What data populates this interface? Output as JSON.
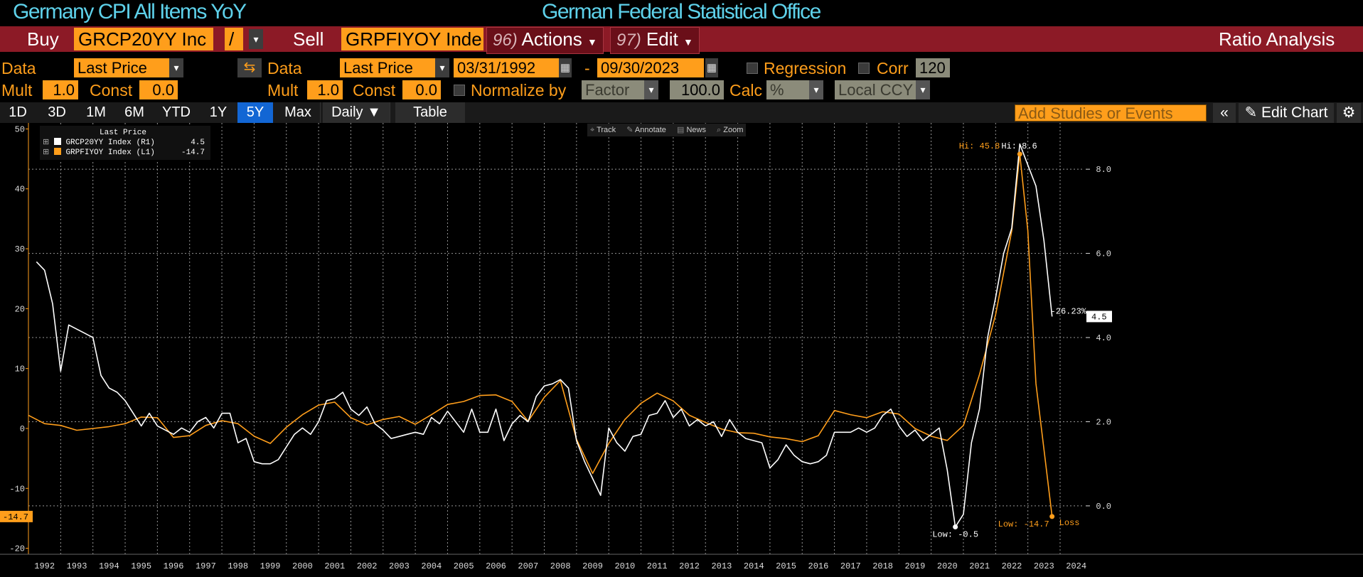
{
  "header": {
    "title": "Germany CPI All Items YoY",
    "source": "German Federal Statistical Office"
  },
  "toolbar": {
    "buy_label": "Buy",
    "buy_ticker": "GRCP20YY Inc",
    "operator": "/",
    "sell_label": "Sell",
    "sell_ticker": "GRPFIYOY Inde",
    "actions_num": "96)",
    "actions_label": "Actions",
    "edit_num": "97)",
    "edit_label": "Edit",
    "ratio_analysis": "Ratio Analysis"
  },
  "settings": {
    "data_label": "Data",
    "data_left": "Last Price",
    "data_label2": "Data",
    "data_right": "Last Price",
    "start_date": "03/31/1992",
    "dash": "-",
    "end_date": "09/30/2023",
    "regression_label": "Regression",
    "corr_label": "Corr",
    "corr_value": "120",
    "mult_label": "Mult",
    "mult_left": "1.0",
    "const_label": "Const",
    "const_left": "0.0",
    "mult_label2": "Mult",
    "mult_right": "1.0",
    "const_label2": "Const",
    "const_right": "0.0",
    "normalize_label": "Normalize by",
    "normalize_value": "Factor",
    "normalize_number": "100.0",
    "calc_label": "Calc",
    "calc_value": "%",
    "currency": "Local CCY"
  },
  "tabs": [
    {
      "label": "1D"
    },
    {
      "label": "3D"
    },
    {
      "label": "1M"
    },
    {
      "label": "6M"
    },
    {
      "label": "YTD"
    },
    {
      "label": "1Y"
    },
    {
      "label": "5Y"
    },
    {
      "label": "Max"
    },
    {
      "label": "Daily ▼"
    },
    {
      "label": "Table"
    }
  ],
  "active_tab": "5Y",
  "studies_placeholder": "Add Studies or Events",
  "edit_chart_label": "Edit Chart",
  "chart_tools": [
    "Track",
    "Annotate",
    "News",
    "Zoom"
  ],
  "colors": {
    "white_series": "#ffffff",
    "orange_series": "#ff9e1b",
    "accent": "#ff9e1b",
    "title": "#5ed1ea",
    "bar": "#8c1a26"
  },
  "chart_data": {
    "type": "line",
    "legend_title": "Last Price",
    "legend_placement": "top-left",
    "grid": true,
    "x_tick_labels": [
      "1992",
      "1993",
      "1994",
      "1995",
      "1996",
      "1997",
      "1998",
      "1999",
      "2000",
      "2001",
      "2002",
      "2003",
      "2004",
      "2005",
      "2006",
      "2007",
      "2008",
      "2009",
      "2010",
      "2011",
      "2012",
      "2013",
      "2014",
      "2015",
      "2016",
      "2017",
      "2018",
      "2019",
      "2020",
      "2021",
      "2022",
      "2023",
      "2024"
    ],
    "xlim": [
      1992.0,
      2024.75
    ],
    "left_axis": {
      "ylim": [
        -21,
        51
      ],
      "ticks": [
        -20,
        -10,
        0,
        10,
        20,
        30,
        40,
        50
      ],
      "tick_labels": [
        "-20",
        "-10",
        "0",
        "10",
        "20",
        "30",
        "40",
        "50"
      ]
    },
    "right_axis": {
      "ylim": [
        -1.15,
        9.1
      ],
      "ticks": [
        0,
        2,
        4,
        6,
        8
      ],
      "tick_labels": [
        "0.0",
        "2.0",
        "4.0",
        "6.0",
        "8.0"
      ]
    },
    "series": [
      {
        "name": "GRCP20YY Index",
        "axis": "R1",
        "last_value_label": "4.5",
        "last_value": 4.5,
        "points": [
          [
            1992.25,
            5.8
          ],
          [
            1992.5,
            5.6
          ],
          [
            1992.75,
            4.8
          ],
          [
            1993.0,
            3.2
          ],
          [
            1993.25,
            4.3
          ],
          [
            1993.5,
            4.2
          ],
          [
            1993.75,
            4.1
          ],
          [
            1994.0,
            4.0
          ],
          [
            1994.25,
            3.1
          ],
          [
            1994.5,
            2.8
          ],
          [
            1994.75,
            2.7
          ],
          [
            1995.0,
            2.5
          ],
          [
            1995.25,
            2.2
          ],
          [
            1995.5,
            1.9
          ],
          [
            1995.75,
            2.2
          ],
          [
            1996.0,
            1.9
          ],
          [
            1996.25,
            1.8
          ],
          [
            1996.5,
            1.7
          ],
          [
            1996.75,
            1.85
          ],
          [
            1997.0,
            1.75
          ],
          [
            1997.25,
            2.0
          ],
          [
            1997.5,
            2.1
          ],
          [
            1997.75,
            1.85
          ],
          [
            1998.0,
            2.2
          ],
          [
            1998.25,
            2.2
          ],
          [
            1998.5,
            1.5
          ],
          [
            1998.75,
            1.6
          ],
          [
            1999.0,
            1.05
          ],
          [
            1999.25,
            1.0
          ],
          [
            1999.5,
            1.0
          ],
          [
            1999.75,
            1.1
          ],
          [
            2000.0,
            1.4
          ],
          [
            2000.25,
            1.7
          ],
          [
            2000.5,
            1.85
          ],
          [
            2000.75,
            1.7
          ],
          [
            2001.0,
            2.0
          ],
          [
            2001.25,
            2.5
          ],
          [
            2001.5,
            2.55
          ],
          [
            2001.75,
            2.7
          ],
          [
            2002.0,
            2.3
          ],
          [
            2002.25,
            2.15
          ],
          [
            2002.5,
            2.35
          ],
          [
            2002.75,
            1.95
          ],
          [
            2003.0,
            1.8
          ],
          [
            2003.25,
            1.6
          ],
          [
            2003.5,
            1.65
          ],
          [
            2003.75,
            1.7
          ],
          [
            2004.0,
            1.75
          ],
          [
            2004.25,
            1.7
          ],
          [
            2004.5,
            2.1
          ],
          [
            2004.75,
            1.95
          ],
          [
            2005.0,
            2.25
          ],
          [
            2005.25,
            2.0
          ],
          [
            2005.5,
            1.75
          ],
          [
            2005.75,
            2.3
          ],
          [
            2006.0,
            1.75
          ],
          [
            2006.25,
            1.75
          ],
          [
            2006.5,
            2.3
          ],
          [
            2006.75,
            1.55
          ],
          [
            2007.0,
            1.95
          ],
          [
            2007.25,
            2.15
          ],
          [
            2007.5,
            2.0
          ],
          [
            2007.75,
            2.6
          ],
          [
            2008.0,
            2.85
          ],
          [
            2008.25,
            2.9
          ],
          [
            2008.5,
            3.0
          ],
          [
            2008.75,
            2.8
          ],
          [
            2009.0,
            1.55
          ],
          [
            2009.25,
            1.05
          ],
          [
            2009.5,
            0.65
          ],
          [
            2009.75,
            0.25
          ],
          [
            2010.0,
            1.85
          ],
          [
            2010.25,
            1.5
          ],
          [
            2010.5,
            1.3
          ],
          [
            2010.75,
            1.65
          ],
          [
            2011.0,
            1.7
          ],
          [
            2011.25,
            2.15
          ],
          [
            2011.5,
            2.2
          ],
          [
            2011.75,
            2.5
          ],
          [
            2012.0,
            2.1
          ],
          [
            2012.25,
            2.3
          ],
          [
            2012.5,
            1.9
          ],
          [
            2012.75,
            2.05
          ],
          [
            2013.0,
            1.9
          ],
          [
            2013.25,
            2.0
          ],
          [
            2013.5,
            1.65
          ],
          [
            2013.75,
            2.05
          ],
          [
            2014.0,
            1.75
          ],
          [
            2014.25,
            1.6
          ],
          [
            2014.5,
            1.55
          ],
          [
            2014.75,
            1.5
          ],
          [
            2015.0,
            0.9
          ],
          [
            2015.25,
            1.1
          ],
          [
            2015.5,
            1.45
          ],
          [
            2015.75,
            1.2
          ],
          [
            2016.0,
            1.05
          ],
          [
            2016.25,
            1.0
          ],
          [
            2016.5,
            1.05
          ],
          [
            2016.75,
            1.2
          ],
          [
            2017.0,
            1.75
          ],
          [
            2017.25,
            1.75
          ],
          [
            2017.5,
            1.75
          ],
          [
            2017.75,
            1.85
          ],
          [
            2018.0,
            1.75
          ],
          [
            2018.25,
            1.85
          ],
          [
            2018.5,
            2.15
          ],
          [
            2018.75,
            2.3
          ],
          [
            2018.0,
            1.75
          ],
          [
            2019.0,
            1.9
          ],
          [
            2019.25,
            1.65
          ],
          [
            2019.5,
            1.8
          ],
          [
            2019.75,
            1.55
          ],
          [
            2020.0,
            1.7
          ],
          [
            2020.25,
            1.85
          ],
          [
            2020.5,
            0.85
          ],
          [
            2020.75,
            -0.5
          ],
          [
            2021.0,
            -0.2
          ],
          [
            2021.25,
            1.5
          ],
          [
            2021.5,
            2.3
          ],
          [
            2021.75,
            4.0
          ],
          [
            2022.0,
            4.95
          ],
          [
            2022.25,
            6.0
          ],
          [
            2022.5,
            6.6
          ],
          [
            2022.75,
            8.6
          ],
          [
            2023.0,
            8.1
          ],
          [
            2023.25,
            7.6
          ],
          [
            2023.5,
            6.3
          ],
          [
            2023.75,
            4.5
          ]
        ]
      },
      {
        "name": "GRPFIYOY Index",
        "axis": "L1",
        "last_value_label": "-14.7",
        "last_value": -14.7,
        "points": [
          [
            1992.0,
            2.2
          ],
          [
            1992.5,
            0.8
          ],
          [
            1993.0,
            0.5
          ],
          [
            1993.5,
            -0.3
          ],
          [
            1994.0,
            0.0
          ],
          [
            1994.5,
            0.3
          ],
          [
            1995.0,
            0.8
          ],
          [
            1995.5,
            1.9
          ],
          [
            1996.0,
            1.8
          ],
          [
            1996.5,
            -1.5
          ],
          [
            1997.0,
            -1.2
          ],
          [
            1997.5,
            0.5
          ],
          [
            1998.0,
            1.3
          ],
          [
            1998.5,
            0.8
          ],
          [
            1999.0,
            -1.3
          ],
          [
            1999.5,
            -2.5
          ],
          [
            2000.0,
            0.2
          ],
          [
            2000.5,
            2.3
          ],
          [
            2001.0,
            3.9
          ],
          [
            2001.5,
            4.4
          ],
          [
            2002.0,
            1.8
          ],
          [
            2002.5,
            0.6
          ],
          [
            2003.0,
            1.5
          ],
          [
            2003.5,
            2.0
          ],
          [
            2004.0,
            0.7
          ],
          [
            2004.5,
            2.3
          ],
          [
            2005.0,
            4.0
          ],
          [
            2005.5,
            4.5
          ],
          [
            2006.0,
            5.5
          ],
          [
            2006.5,
            5.6
          ],
          [
            2007.0,
            4.5
          ],
          [
            2007.5,
            1.2
          ],
          [
            2008.0,
            5.2
          ],
          [
            2008.5,
            8.0
          ],
          [
            2009.0,
            -1.8
          ],
          [
            2009.5,
            -7.5
          ],
          [
            2010.0,
            -2.5
          ],
          [
            2010.5,
            1.5
          ],
          [
            2011.0,
            4.2
          ],
          [
            2011.5,
            5.9
          ],
          [
            2012.0,
            4.6
          ],
          [
            2012.5,
            2.2
          ],
          [
            2013.0,
            1.0
          ],
          [
            2013.5,
            -0.1
          ],
          [
            2014.0,
            -0.7
          ],
          [
            2014.5,
            -0.8
          ],
          [
            2015.0,
            -1.4
          ],
          [
            2015.5,
            -1.7
          ],
          [
            2016.0,
            -2.2
          ],
          [
            2016.5,
            -1.2
          ],
          [
            2017.0,
            3.0
          ],
          [
            2017.5,
            2.3
          ],
          [
            2018.0,
            1.8
          ],
          [
            2018.5,
            2.8
          ],
          [
            2019.0,
            2.4
          ],
          [
            2019.5,
            0.0
          ],
          [
            2020.0,
            -1.3
          ],
          [
            2020.5,
            -2.0
          ],
          [
            2021.0,
            0.5
          ],
          [
            2021.5,
            9.0
          ],
          [
            2021.75,
            14.0
          ],
          [
            2022.0,
            19.0
          ],
          [
            2022.25,
            26.0
          ],
          [
            2022.5,
            33.0
          ],
          [
            2022.75,
            45.8
          ],
          [
            2023.0,
            33.0
          ],
          [
            2023.25,
            7.5
          ],
          [
            2023.5,
            -3.5
          ],
          [
            2023.75,
            -14.7
          ]
        ]
      }
    ],
    "annotations": [
      {
        "text": "Hi: 45.8",
        "series": "GRPFIYOY Index",
        "x": 2022.75,
        "y": 45.8
      },
      {
        "text": "Hi: 8.6",
        "series": "GRCP20YY Index",
        "x": 2022.75,
        "y": 8.6
      },
      {
        "text": "Low: -0.5",
        "series": "GRCP20YY Index",
        "x": 2020.75,
        "y": -0.5
      },
      {
        "text": "Low: -14.7",
        "series": "GRPFIYOY Index",
        "x": 2023.75,
        "y": -14.7
      },
      {
        "text": "Loss",
        "series": "GRPFIYOY Index"
      },
      {
        "text": "-26.23%",
        "series": "GRCP20YY Index"
      }
    ]
  }
}
